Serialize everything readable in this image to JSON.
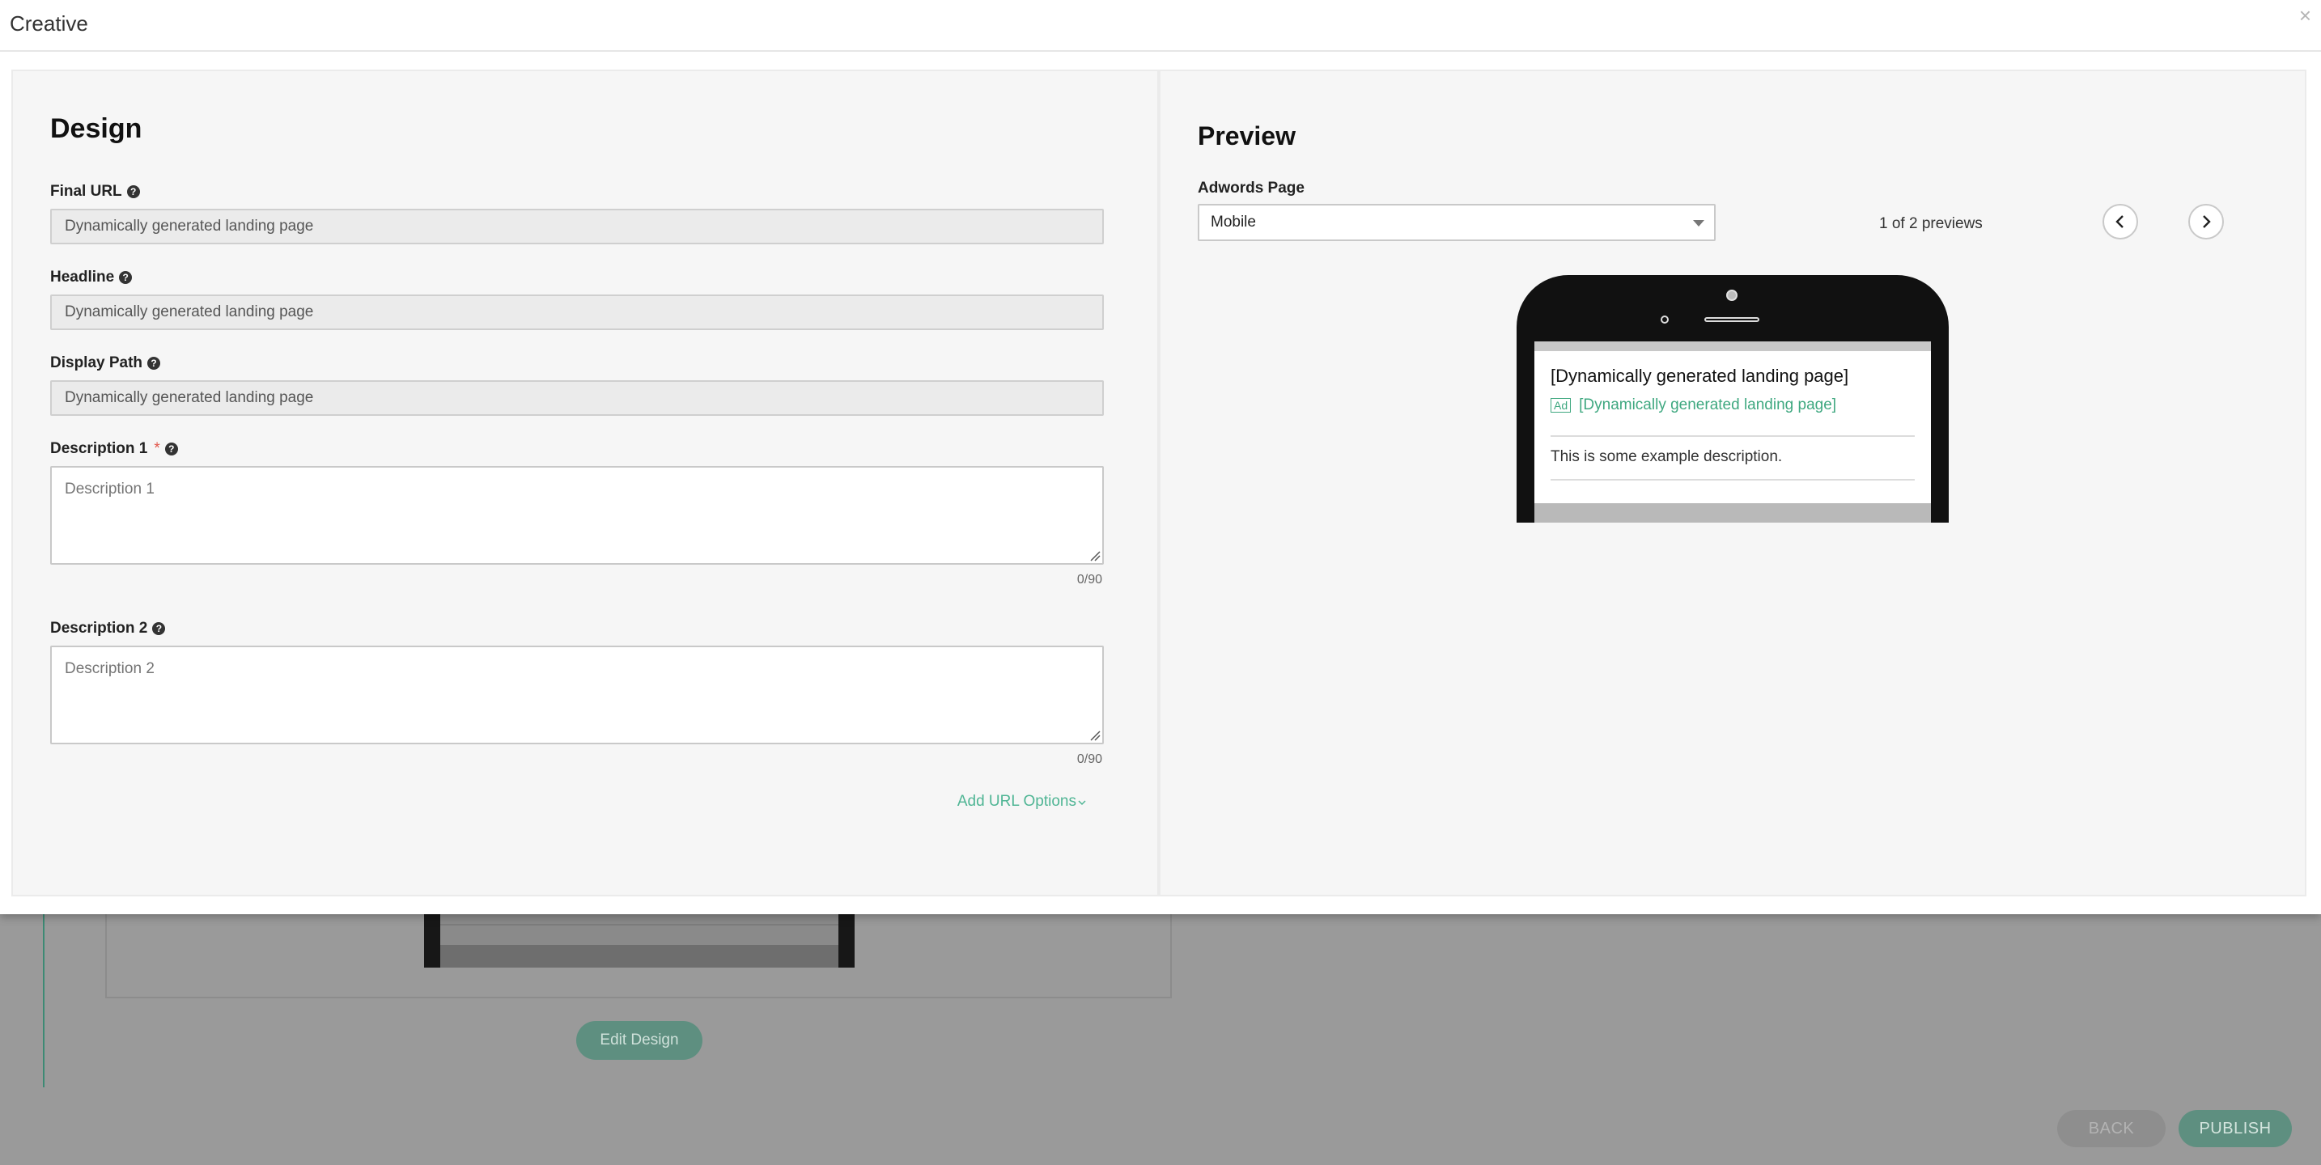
{
  "modal": {
    "title": "Creative",
    "close_label": "×"
  },
  "design": {
    "heading": "Design",
    "final_url": {
      "label": "Final URL",
      "value": "Dynamically generated landing page"
    },
    "headline": {
      "label": "Headline",
      "value": "Dynamically generated landing page"
    },
    "display_path": {
      "label": "Display Path",
      "value": "Dynamically generated landing page"
    },
    "description1": {
      "label": "Description 1",
      "required_mark": "*",
      "placeholder": "Description 1",
      "counter": "0/90"
    },
    "description2": {
      "label": "Description 2",
      "placeholder": "Description 2",
      "counter": "0/90"
    },
    "add_url_options": "Add URL Options"
  },
  "preview": {
    "heading": "Preview",
    "adwords_label": "Adwords Page",
    "selected_option": "Mobile",
    "count_text": "1 of 2 previews",
    "ad": {
      "headline": "[Dynamically generated landing page]",
      "badge": "Ad",
      "url": "[Dynamically generated landing page]",
      "description": "This is some example description."
    }
  },
  "background": {
    "edit_design": "Edit Design",
    "back": "BACK",
    "publish": "PUBLISH"
  },
  "colors": {
    "accent": "#4fb594",
    "overlay": "#9a9a9a",
    "required": "#e2574c"
  },
  "icons": {
    "help": "question-circle-icon",
    "close": "close-icon",
    "prev": "chevron-left-icon",
    "next": "chevron-right-icon",
    "dropdown": "caret-down-icon"
  }
}
